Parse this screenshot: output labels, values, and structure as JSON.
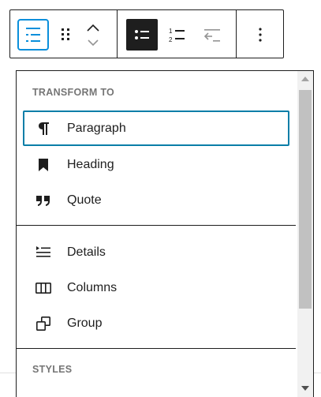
{
  "toolbar": {
    "buttons": [
      {
        "name": "list-block-button",
        "icon": "list-block-icon",
        "active": true
      },
      {
        "name": "drag-handle",
        "icon": "drag-dots-icon"
      },
      {
        "name": "move-up-button",
        "icon": "chevron-up-icon"
      },
      {
        "name": "move-down-button",
        "icon": "chevron-down-icon",
        "disabled": true
      },
      {
        "name": "unordered-list-button",
        "icon": "unordered-list-icon",
        "pressed": true
      },
      {
        "name": "ordered-list-button",
        "icon": "ordered-list-icon"
      },
      {
        "name": "outdent-button",
        "icon": "outdent-icon",
        "disabled": true
      },
      {
        "name": "options-button",
        "icon": "more-vertical-icon"
      }
    ]
  },
  "dropdown": {
    "transform_title": "TRANSFORM TO",
    "transform_items": [
      {
        "label": "Paragraph",
        "icon": "pilcrow-icon",
        "focused": true
      },
      {
        "label": "Heading",
        "icon": "bookmark-icon"
      },
      {
        "label": "Quote",
        "icon": "quote-icon"
      }
    ],
    "more_items": [
      {
        "label": "Details",
        "icon": "details-icon"
      },
      {
        "label": "Columns",
        "icon": "columns-icon"
      },
      {
        "label": "Group",
        "icon": "group-icon"
      }
    ],
    "styles_title": "STYLES"
  },
  "colors": {
    "focus_blue": "#0a8fdb",
    "text": "#1e1e1e",
    "muted": "#757575",
    "disabled": "#949494"
  }
}
